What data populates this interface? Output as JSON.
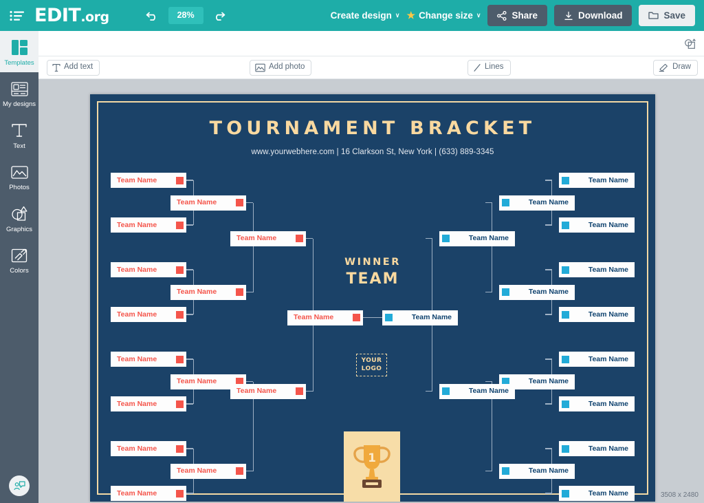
{
  "header": {
    "menu_icon": "hamburger-icon",
    "brand_name": "EDIT",
    "brand_suffix": ".org",
    "undo_icon": "undo-icon",
    "redo_icon": "redo-icon",
    "zoom_level": "28%",
    "create_design_label": "Create design",
    "create_design_caret": "∨",
    "change_size_label": "Change size",
    "change_size_caret": "∨",
    "change_size_star": "★",
    "share_label": "Share",
    "download_label": "Download",
    "save_label": "Save"
  },
  "sidebar": {
    "items": [
      {
        "label": "Templates",
        "icon": "templates-icon",
        "active": true
      },
      {
        "label": "My designs",
        "icon": "my-designs-icon",
        "active": false
      },
      {
        "label": "Text",
        "icon": "text-icon",
        "active": false
      },
      {
        "label": "Photos",
        "icon": "photos-icon",
        "active": false
      },
      {
        "label": "Graphics",
        "icon": "graphics-icon",
        "active": false
      },
      {
        "label": "Colors",
        "icon": "colors-icon",
        "active": false
      }
    ],
    "support_icon": "support-chat-icon"
  },
  "toolbar": {
    "top_right_icon": "object-resize-icon",
    "add_text_label": "Add text",
    "add_text_icon": "text-tool-icon",
    "add_photo_label": "Add photo",
    "add_photo_icon": "photo-tool-icon",
    "lines_label": "Lines",
    "lines_icon": "line-tool-icon",
    "draw_label": "Draw",
    "draw_icon": "draw-tool-icon"
  },
  "canvas": {
    "resolution": "3508 x 2480",
    "background_color": "#1b4268",
    "border_color": "#f3d9a4",
    "accent_gold": "#f9d9a0",
    "left_team_color": "#f4554b",
    "right_team_color": "#10436f",
    "left_chip_color": "#f4554b",
    "right_chip_color": "#22abd8",
    "connector_color": "#9fb1c4"
  },
  "poster": {
    "title": "TOURNAMENT BRACKET",
    "subtitle": "www.yourwebhere.com | 16 Clarkson St, New York | (633) 889-3345",
    "winner_line1": "WINNER",
    "winner_line2": "TEAM",
    "logo_line1": "YOUR",
    "logo_line2": "LOGO",
    "trophy_icon": "trophy-icon",
    "trophy_rank": "1",
    "team_label": "Team Name"
  },
  "bracket": {
    "left": {
      "round1": [
        {
          "label": "Team Name"
        },
        {
          "label": "Team Name"
        },
        {
          "label": "Team Name"
        },
        {
          "label": "Team Name"
        },
        {
          "label": "Team Name"
        },
        {
          "label": "Team Name"
        },
        {
          "label": "Team Name"
        },
        {
          "label": "Team Name"
        }
      ],
      "round2": [
        {
          "label": "Team Name"
        },
        {
          "label": "Team Name"
        },
        {
          "label": "Team Name"
        },
        {
          "label": "Team Name"
        }
      ],
      "round3": [
        {
          "label": "Team Name"
        },
        {
          "label": "Team Name"
        }
      ],
      "final": [
        {
          "label": "Team Name"
        }
      ]
    },
    "right": {
      "round1": [
        {
          "label": "Team Name"
        },
        {
          "label": "Team Name"
        },
        {
          "label": "Team Name"
        },
        {
          "label": "Team Name"
        },
        {
          "label": "Team Name"
        },
        {
          "label": "Team Name"
        },
        {
          "label": "Team Name"
        },
        {
          "label": "Team Name"
        }
      ],
      "round2": [
        {
          "label": "Team Name"
        },
        {
          "label": "Team Name"
        },
        {
          "label": "Team Name"
        },
        {
          "label": "Team Name"
        }
      ],
      "round3": [
        {
          "label": "Team Name"
        },
        {
          "label": "Team Name"
        }
      ],
      "final": [
        {
          "label": "Team Name"
        }
      ]
    }
  }
}
